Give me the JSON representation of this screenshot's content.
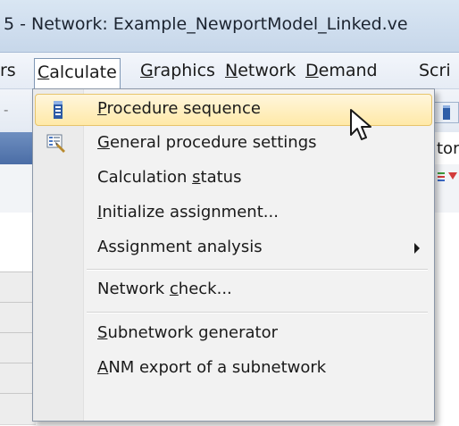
{
  "window": {
    "title": "5 - Network: Example_NewportModel_Linked.ve"
  },
  "menubar": {
    "items": [
      {
        "label": "rs",
        "mnemonic_index": -1
      },
      {
        "label": "Calculate",
        "mnemonic_index": 0
      },
      {
        "label": "Graphics",
        "mnemonic_index": 0
      },
      {
        "label": "Network",
        "mnemonic_index": 0
      },
      {
        "label": "Demand",
        "mnemonic_index": 0
      },
      {
        "label": "Scri",
        "mnemonic_index": -1
      }
    ],
    "active": "Calculate"
  },
  "background": {
    "partial_tab_text": "tor",
    "dropdown_glyph": "-"
  },
  "calculate_menu": {
    "items": [
      {
        "label_pre": "",
        "label_u": "P",
        "label_post": "rocedure sequence",
        "icon": "procedure-sequence-icon",
        "highlighted": true
      },
      {
        "label_pre": "",
        "label_u": "G",
        "label_post": "eneral procedure settings",
        "icon": "settings-icon",
        "highlighted": false
      },
      {
        "label_pre": "Calculation ",
        "label_u": "s",
        "label_post": "tatus",
        "icon": "",
        "highlighted": false
      },
      {
        "label_pre": "",
        "label_u": "I",
        "label_post": "nitialize assignment...",
        "icon": "",
        "highlighted": false
      },
      {
        "label_pre": "Assignment analysis",
        "label_u": "",
        "label_post": "",
        "icon": "submenu-arrow-icon",
        "highlighted": false
      },
      {
        "label_pre": "Network ",
        "label_u": "c",
        "label_post": "heck...",
        "icon": "",
        "highlighted": false
      },
      {
        "label_pre": "",
        "label_u": "S",
        "label_post": "ubnetwork generator",
        "icon": "",
        "highlighted": false
      },
      {
        "label_pre": "",
        "label_u": "A",
        "label_post": "NM export of a subnetwork",
        "icon": "",
        "highlighted": false
      }
    ]
  },
  "colors": {
    "highlight": "#ffe9a8",
    "highlight_border": "#e7c46b",
    "menu_bg": "#f2f2f2",
    "header_blue": "#4b6da6"
  }
}
